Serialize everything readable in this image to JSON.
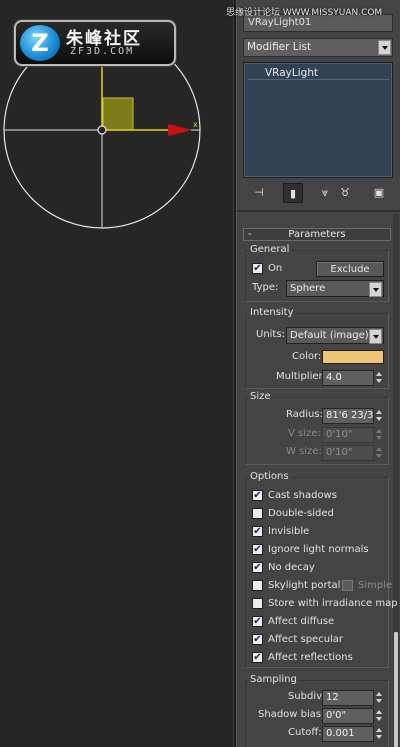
{
  "watermark": "思缘设计论坛 WWW.MISSYUAN.COM",
  "logo": {
    "title_cn": "朱峰社区",
    "subtitle": "ZF3D.COM",
    "mark": "Z"
  },
  "top_field": "VRayLight01",
  "modifier_list": {
    "label": "Modifier List"
  },
  "stack": {
    "items": [
      "VRayLight"
    ]
  },
  "rollout": {
    "title": "Parameters",
    "collapse": "-"
  },
  "general": {
    "title": "General",
    "on_label": "On",
    "on_checked": true,
    "exclude_label": "Exclude",
    "type_label": "Type:",
    "type_value": "Sphere"
  },
  "intensity": {
    "title": "Intensity",
    "units_label": "Units:",
    "units_value": "Default (image)",
    "color_label": "Color:",
    "color_hex": "#f0c475",
    "multiplier_label": "Multiplier:",
    "multiplier_value": "4.0"
  },
  "size": {
    "title": "Size",
    "radius_label": "Radius:",
    "radius_value": "81'6 23/3",
    "vsize_label": "V size:",
    "vsize_value": "0'10\"",
    "wsize_label": "W size:",
    "wsize_value": "0'10\""
  },
  "options": {
    "title": "Options",
    "items": [
      {
        "label": "Cast shadows",
        "checked": true
      },
      {
        "label": "Double-sided",
        "checked": false
      },
      {
        "label": "Invisible",
        "checked": true
      },
      {
        "label": "Ignore light normals",
        "checked": true
      },
      {
        "label": "No decay",
        "checked": true
      },
      {
        "label": "Skylight portal",
        "checked": false
      },
      {
        "label": "Store with irradiance map",
        "checked": false
      },
      {
        "label": "Affect diffuse",
        "checked": true
      },
      {
        "label": "Affect specular",
        "checked": true
      },
      {
        "label": "Affect reflections",
        "checked": true
      }
    ],
    "simple_label": "Simple"
  },
  "sampling": {
    "title": "Sampling",
    "subdivs_label": "Subdivs:",
    "subdivs_value": "12",
    "shadow_bias_label": "Shadow bias:",
    "shadow_bias_value": "0'0\"",
    "cutoff_label": "Cutoff:",
    "cutoff_value": "0.001"
  },
  "colors": {
    "viewport_bg": "#262626",
    "panel_bg": "#444444",
    "gizmo_box": "#8c8a1f",
    "axis_x": "#cc1010",
    "axis_y": "#e6d21a"
  }
}
